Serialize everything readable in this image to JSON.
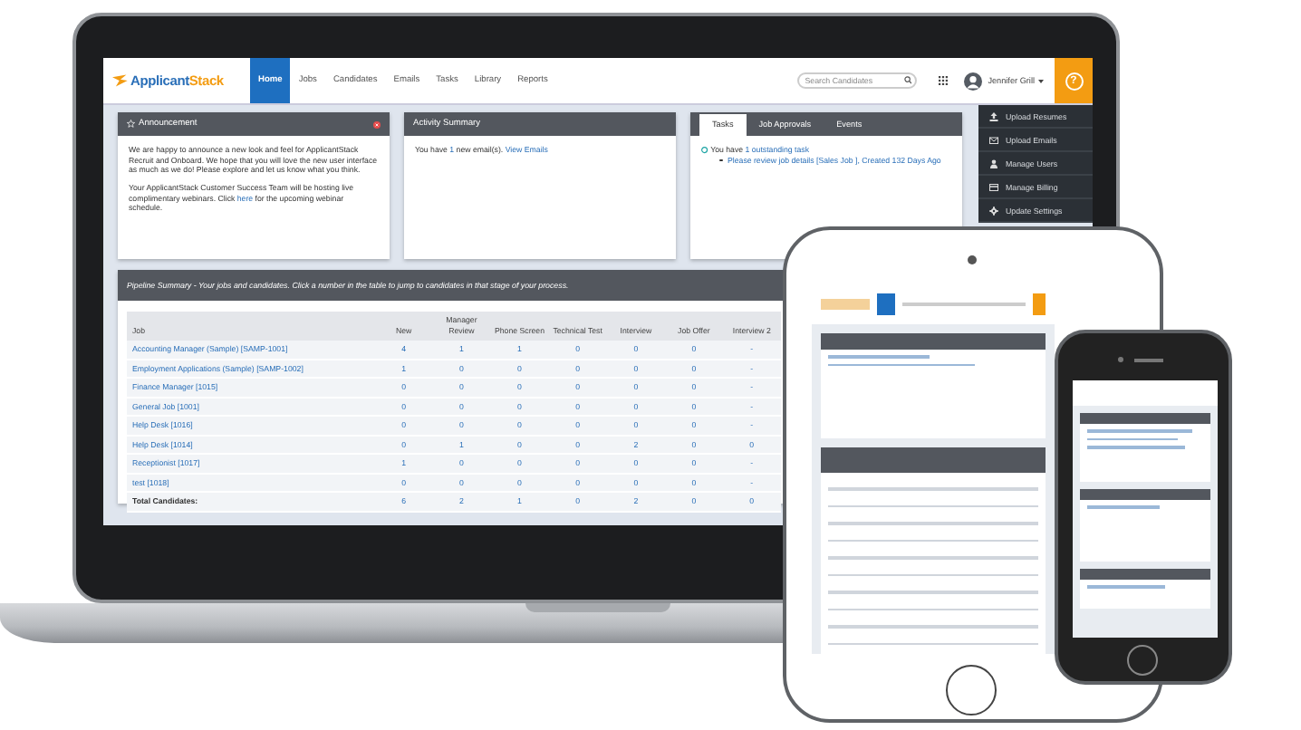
{
  "app": {
    "logo": [
      "Applicant",
      "Stack"
    ],
    "nav": [
      {
        "label": "Home",
        "selected": true
      },
      {
        "label": "Jobs",
        "selected": false
      },
      {
        "label": "Candidates",
        "selected": false
      },
      {
        "label": "Emails",
        "selected": false
      },
      {
        "label": "Tasks",
        "selected": false
      },
      {
        "label": "Library",
        "selected": false
      },
      {
        "label": "Reports",
        "selected": false
      }
    ],
    "search": {
      "placeholder": "Search Candidates"
    },
    "user": {
      "name": "Jennifer Grill"
    },
    "help_button": "?"
  },
  "announcement": {
    "title": "Announcement",
    "paragraphs": [
      [
        {
          "text": "We are happy to announce a new look and feel for ApplicantStack Recruit and Onboard. We hope that you will love the new user interface as much as we do! Please explore and let us know what you think.",
          "link": false
        }
      ],
      [
        {
          "text": "Your ApplicantStack Customer Success Team will be hosting live complimentary webinars. Click ",
          "link": false
        },
        {
          "text": "here",
          "link": true
        },
        {
          "text": " for the upcoming webinar schedule.",
          "link": false
        }
      ]
    ]
  },
  "activity": {
    "title": "Activity Summary",
    "parts": [
      {
        "text": "You have ",
        "link": false
      },
      {
        "text": "1",
        "link": true
      },
      {
        "text": " new email(s). ",
        "link": false
      },
      {
        "text": "View Emails",
        "link": true
      }
    ]
  },
  "tasks": {
    "tabs": [
      {
        "label": "Tasks",
        "selected": true
      },
      {
        "label": "Job Approvals",
        "selected": false
      },
      {
        "label": "Events",
        "selected": false
      }
    ],
    "parts": [
      {
        "text": "You have ",
        "link": false
      },
      {
        "text": "1 outstanding task",
        "link": true
      }
    ],
    "items": [
      "Please review job details [Sales Job ], Created 132 Days Ago"
    ]
  },
  "sidebar_menu": [
    {
      "label": "Upload Resumes"
    },
    {
      "label": "Upload Emails"
    },
    {
      "label": "Manage Users"
    },
    {
      "label": "Manage Billing"
    },
    {
      "label": "Update Settings"
    }
  ],
  "pipeline": {
    "title": "Pipeline Summary - Your jobs and candidates. Click a number in the table to jump to candidates in that stage of your process.",
    "columns": [
      "Job",
      "New",
      "Manager Review",
      "Phone Screen",
      "Technical Test",
      "Interview",
      "Job Offer",
      "Interview 2"
    ],
    "rows": [
      {
        "cells": [
          "Accounting Manager (Sample) [SAMP-1001]",
          "4",
          "1",
          "1",
          "0",
          "0",
          "0",
          "-"
        ]
      },
      {
        "cells": [
          "Employment Applications (Sample) [SAMP-1002]",
          "1",
          "0",
          "0",
          "0",
          "0",
          "0",
          "-"
        ]
      },
      {
        "cells": [
          "Finance Manager [1015]",
          "0",
          "0",
          "0",
          "0",
          "0",
          "0",
          "-"
        ]
      },
      {
        "cells": [
          "General Job [1001]",
          "0",
          "0",
          "0",
          "0",
          "0",
          "0",
          "-"
        ]
      },
      {
        "cells": [
          "Help Desk [1016]",
          "0",
          "0",
          "0",
          "0",
          "0",
          "0",
          "-"
        ]
      },
      {
        "cells": [
          "Help Desk [1014]",
          "0",
          "1",
          "0",
          "0",
          "2",
          "0",
          "0"
        ]
      },
      {
        "cells": [
          "Receptionist [1017]",
          "1",
          "0",
          "0",
          "0",
          "0",
          "0",
          "-"
        ]
      },
      {
        "cells": [
          "test [1018]",
          "0",
          "0",
          "0",
          "0",
          "0",
          "0",
          "-"
        ]
      }
    ],
    "total": {
      "cells": [
        "Total Candidates:",
        "6",
        "2",
        "1",
        "0",
        "2",
        "0",
        "0"
      ]
    }
  }
}
